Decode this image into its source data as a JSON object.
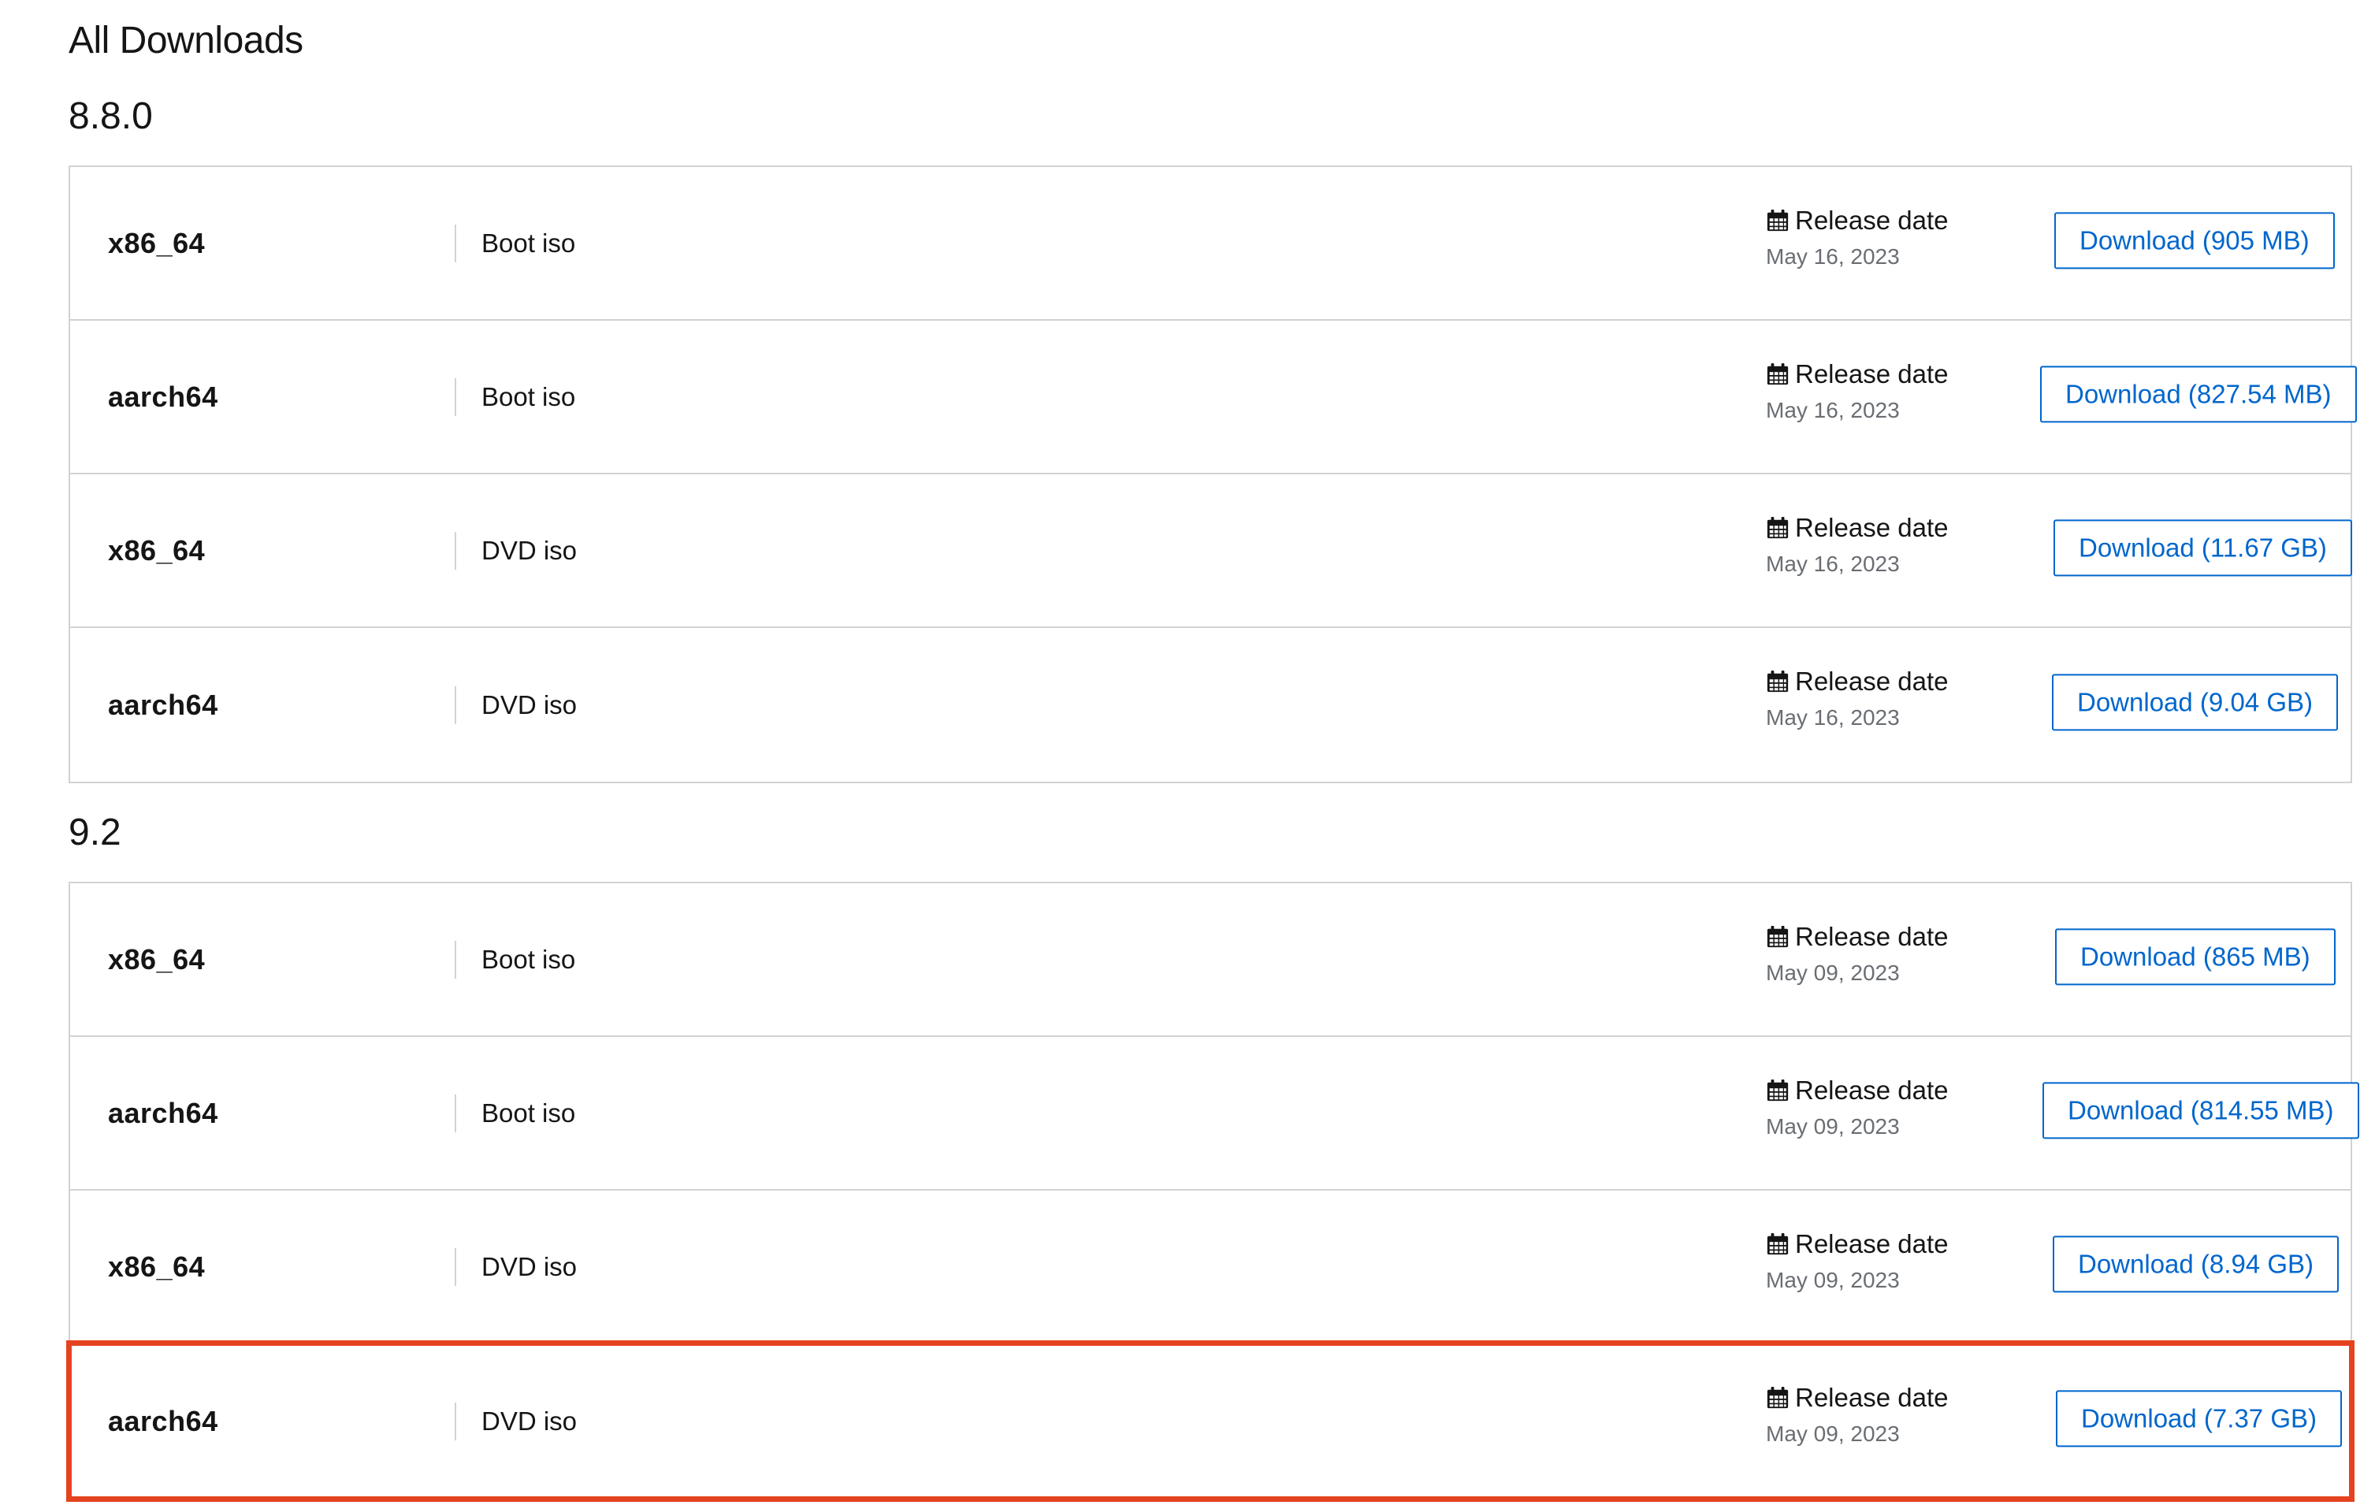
{
  "page": {
    "title": "All Downloads"
  },
  "sections": [
    {
      "version": "8.8.0",
      "rows": [
        {
          "arch": "x86_64",
          "type": "Boot iso",
          "release_label": "Release date",
          "release_date": "May 16, 2023",
          "download_label": "Download (905 MB)"
        },
        {
          "arch": "aarch64",
          "type": "Boot iso",
          "release_label": "Release date",
          "release_date": "May 16, 2023",
          "download_label": "Download (827.54 MB)"
        },
        {
          "arch": "x86_64",
          "type": "DVD iso",
          "release_label": "Release date",
          "release_date": "May 16, 2023",
          "download_label": "Download (11.67 GB)"
        },
        {
          "arch": "aarch64",
          "type": "DVD iso",
          "release_label": "Release date",
          "release_date": "May 16, 2023",
          "download_label": "Download (9.04 GB)"
        }
      ]
    },
    {
      "version": "9.2",
      "rows": [
        {
          "arch": "x86_64",
          "type": "Boot iso",
          "release_label": "Release date",
          "release_date": "May 09, 2023",
          "download_label": "Download (865 MB)"
        },
        {
          "arch": "aarch64",
          "type": "Boot iso",
          "release_label": "Release date",
          "release_date": "May 09, 2023",
          "download_label": "Download (814.55 MB)"
        },
        {
          "arch": "x86_64",
          "type": "DVD iso",
          "release_label": "Release date",
          "release_date": "May 09, 2023",
          "download_label": "Download (8.94 GB)"
        },
        {
          "arch": "aarch64",
          "type": "DVD iso",
          "release_label": "Release date",
          "release_date": "May 09, 2023",
          "download_label": "Download (7.37 GB)"
        }
      ]
    }
  ],
  "icons": {
    "release": "calendar-icon"
  },
  "colors": {
    "link": "#0066cc",
    "border": "#d2d2d2",
    "highlight": "#e5431f",
    "muted_text": "#6a6e73"
  }
}
